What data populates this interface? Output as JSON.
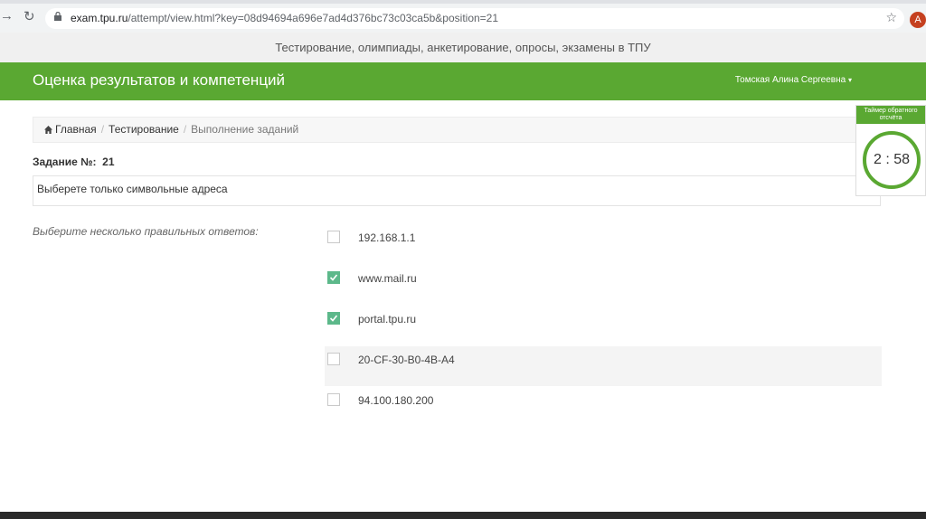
{
  "browser": {
    "url_host": "exam.tpu.ru",
    "url_path": "/attempt/view.html?key=08d94694a696e7ad4d376bc73c03ca5b&position=21",
    "profile_initial": "A"
  },
  "banner": {
    "text": "Тестирование, олимпиады, анкетирование, опросы, экзамены в ТПУ"
  },
  "header": {
    "brand": "Оценка результатов и компетенций",
    "user_name": "Томская Алина Сергеевна",
    "accent": "#5aa832"
  },
  "breadcrumb": [
    {
      "label": "Главная"
    },
    {
      "label": "Тестирование"
    },
    {
      "label": "Выполнение заданий"
    }
  ],
  "question": {
    "label": "Задание №:",
    "number": "21",
    "text": "Выберете только символьные адреса",
    "instruction": "Выберите несколько правильных ответов:"
  },
  "options": [
    {
      "label": "192.168.1.1",
      "checked": false
    },
    {
      "label": "www.mail.ru",
      "checked": true
    },
    {
      "label": "portal.tpu.ru",
      "checked": true
    },
    {
      "label": "20-CF-30-B0-4B-A4",
      "checked": false
    },
    {
      "label": "94.100.180.200",
      "checked": false
    }
  ],
  "timer": {
    "title_line1": "Таймер обратного",
    "title_line2": "отсчёта",
    "value": "2 : 58"
  },
  "icons": {
    "back": "arrow-right-icon",
    "reload": "reload-icon",
    "lock": "lock-icon",
    "star": "star-icon",
    "home": "home-icon",
    "check": "check-icon"
  }
}
